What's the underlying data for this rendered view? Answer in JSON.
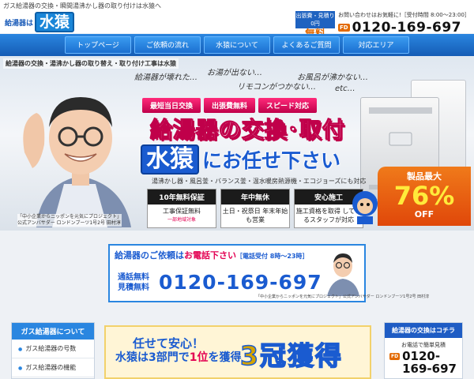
{
  "site": {
    "tagline": "ガス給湯器の交換・瞬間湯沸かし器の取り付けは水猿へ",
    "logo_small": "給湯器は",
    "logo_big": "水猿"
  },
  "header": {
    "badge_top": "出張費・見積り0円",
    "badge_free": "無料",
    "contact_text": "お問い合わせはお気軽に!［受付時間 8:00～23:00］",
    "freedial_label": "フリーダイヤル",
    "phone": "0120-169-697"
  },
  "nav": [
    {
      "label": "トップページ"
    },
    {
      "label": "ご依頼の流れ"
    },
    {
      "label": "水猿について"
    },
    {
      "label": "よくあるご質問"
    },
    {
      "label": "対応エリア"
    }
  ],
  "hero": {
    "caption": "給湯器の交換・湯沸かし器の取り替え・取り付け工事は水猿",
    "bubble1": "給湯器が壊れた…",
    "bubble2": "お湯が出ない…",
    "bubble3": "リモコンがつかない…",
    "bubble4": "お風呂が沸かない…",
    "bubble5": "etc…",
    "tags": [
      "最短当日交換",
      "出張費無料",
      "スピード対応"
    ],
    "headline1": "給湯器の交換･取付",
    "headline2a": "水猿",
    "headline2b": "にお任せ下さい",
    "subline": "湯沸かし器・風呂釜・バランス釜・温水暖房熱源機・エコジョーズにも対応",
    "badges": [
      {
        "title": "10年無料保証",
        "body": "工事保証無料",
        "note": "一部地域対象"
      },
      {
        "title": "年中無休",
        "body": "土日・祝祭日 年末年始も営業",
        "note": ""
      },
      {
        "title": "安心施工",
        "body": "施工資格を取得 しているスタッフが対応",
        "note": ""
      }
    ],
    "discount_label": "製品最大",
    "discount_value": "76%",
    "discount_suffix": "OFF",
    "person_caption_line1": "「中小企業からニッポンを元気にプロジェクト」",
    "person_caption_line2": "公式アンバサダー ロンドンブーツ1号2号 田村淳"
  },
  "banner": {
    "line1_a": "給湯器のご依頼は",
    "line1_b": "お電話下さい",
    "line1_c": "［電話受付 8時～23時］",
    "left_a": "通話無料",
    "left_b": "見積無料",
    "phone": "0120-169-697",
    "caption": "「中小企業からニッポンを元気にプロジェクト」公式アンバサダー ロンドンブーツ1号2号 田村淳"
  },
  "sidebar": {
    "heading": "ガス給湯器について",
    "items": [
      "ガス給湯器の号数",
      "ガス給湯器の機能"
    ]
  },
  "main_card": {
    "line1": "任せて安心！",
    "line2_a": "水猿は3部門で",
    "line2_b": "1位",
    "line2_c": "を獲得",
    "big": "3冠獲得"
  },
  "right_card": {
    "heading": "給湯器の交換はコチラ",
    "sub": "お電話で簡単見積",
    "phone_a": "0120-",
    "phone_b": "169-697"
  },
  "colors": {
    "brand_blue": "#1a5bd0",
    "accent_pink": "#e30052",
    "accent_orange": "#e36a00"
  }
}
